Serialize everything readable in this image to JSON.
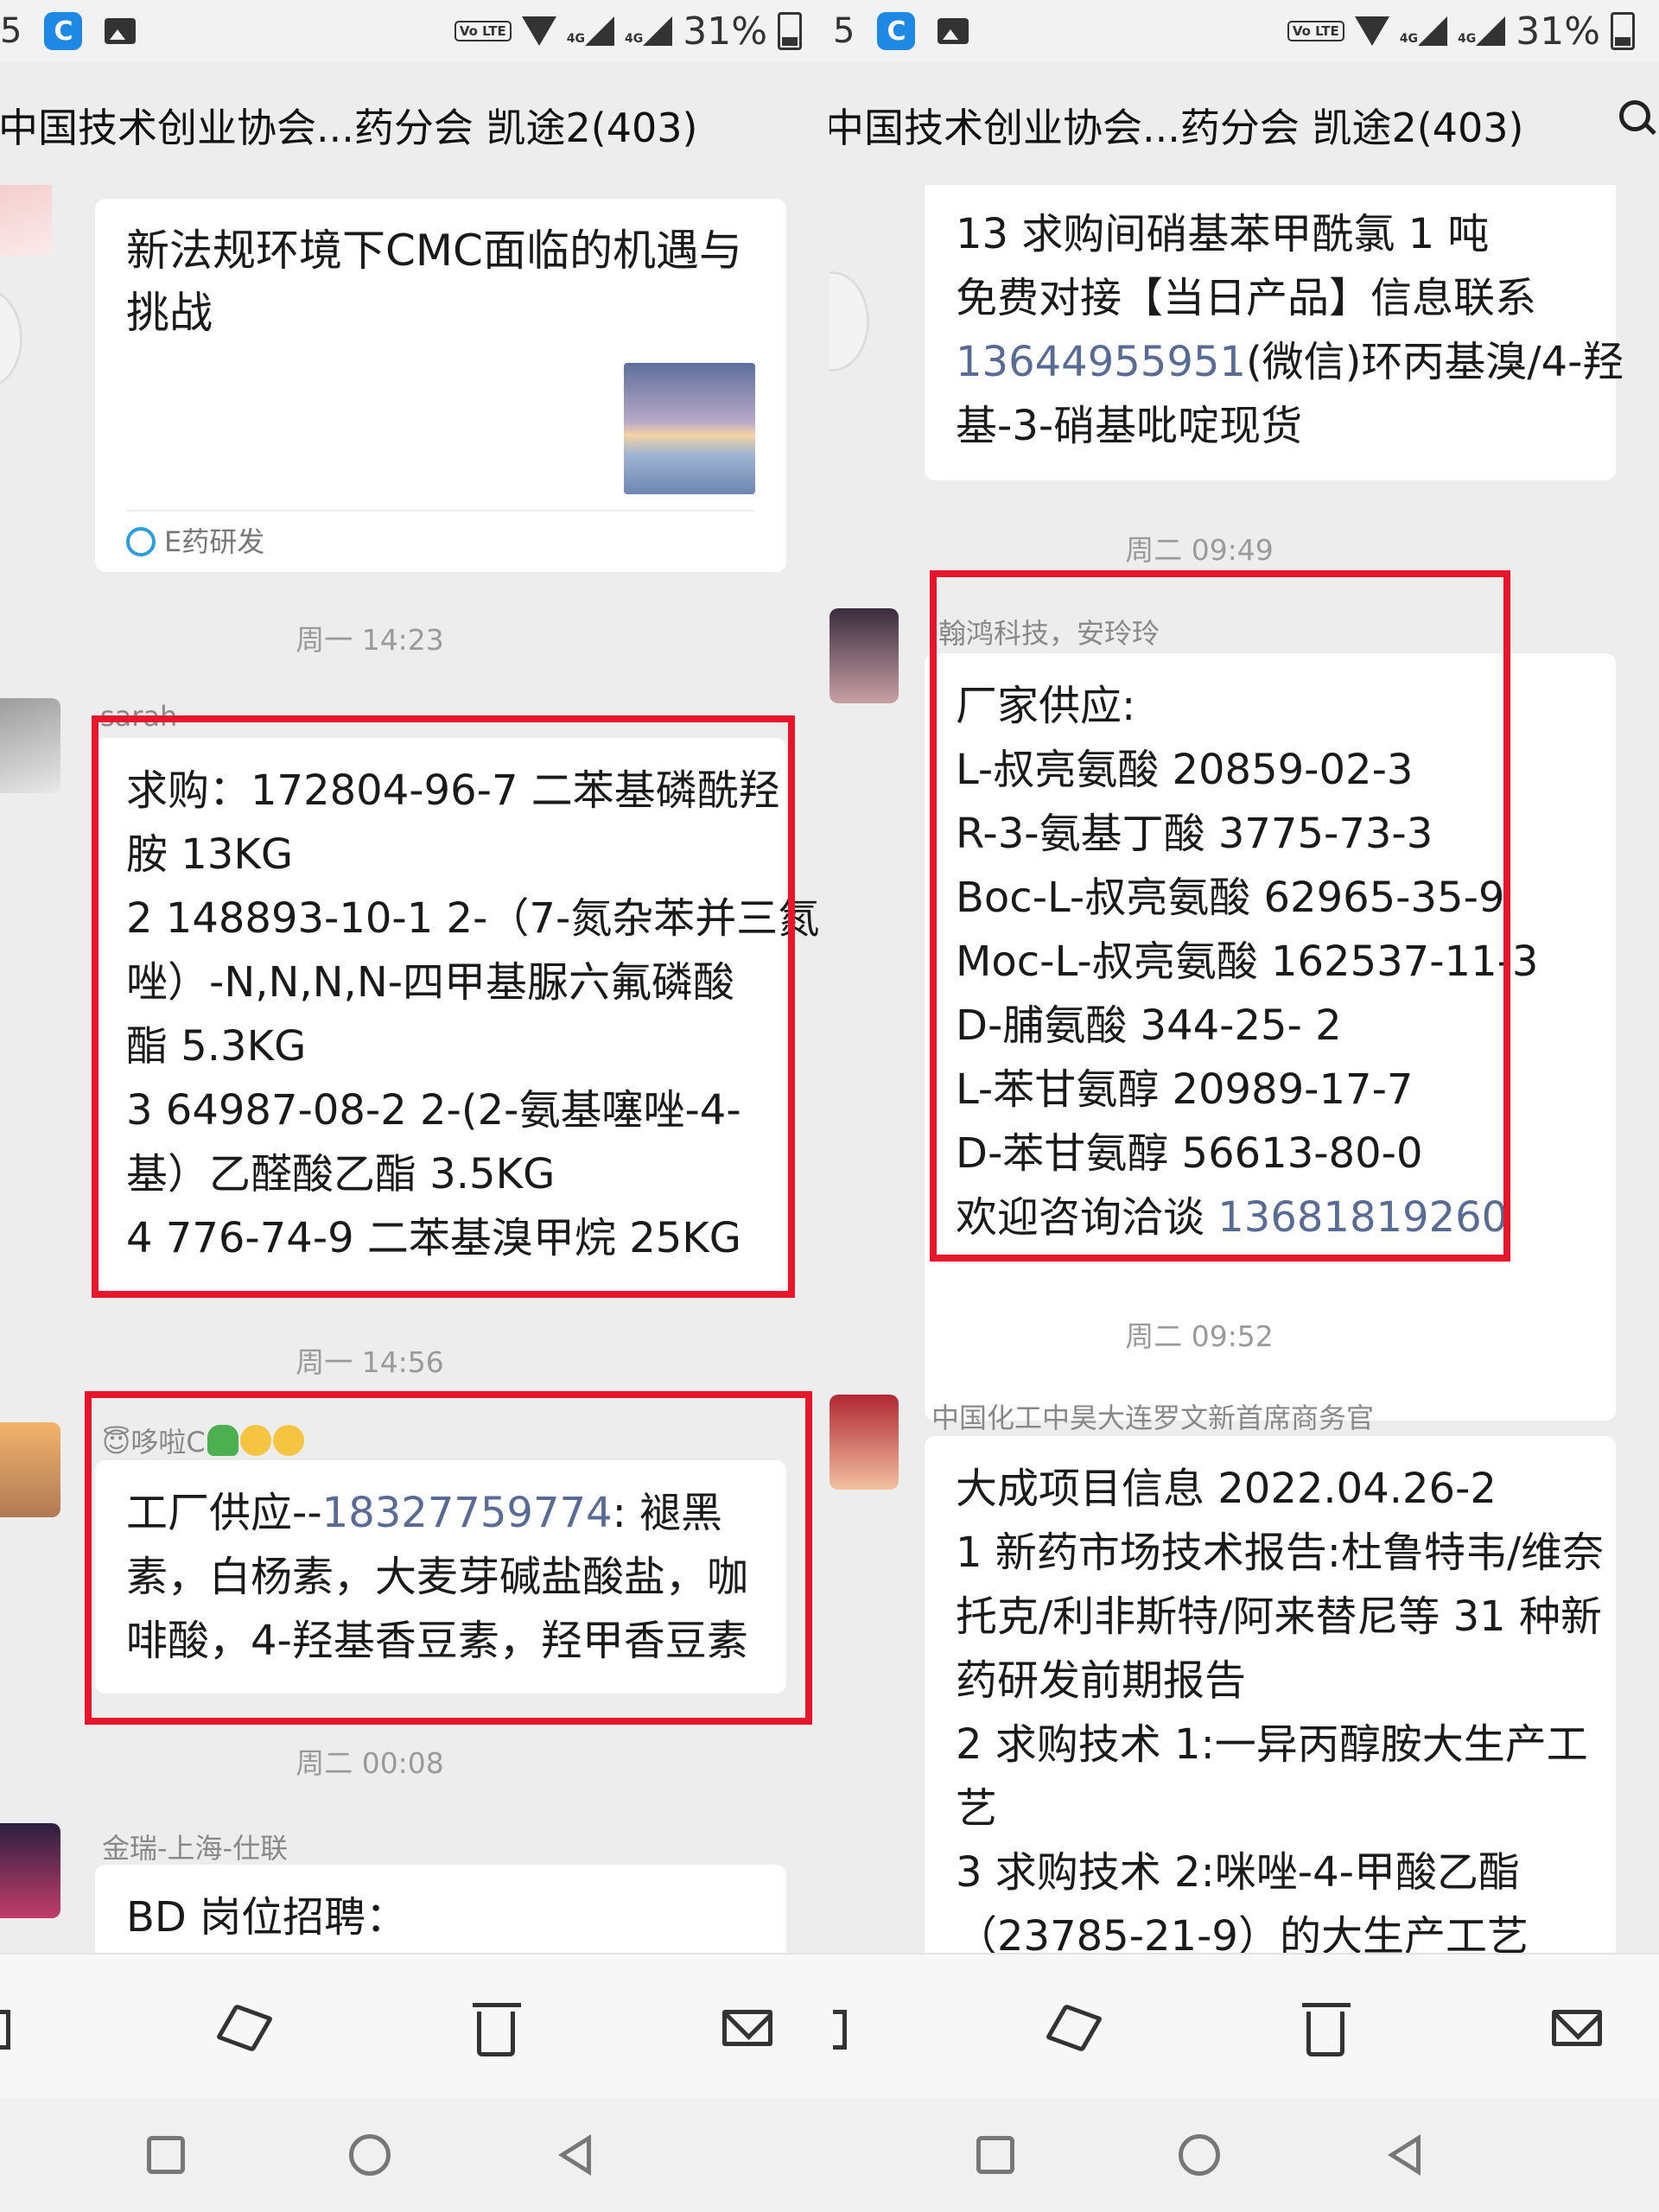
{
  "status_bar": {
    "left_digit": "5",
    "volte": "Vo LTE",
    "network": "4G",
    "battery": "31%"
  },
  "header": {
    "title": "中国技术创业协会...药分会 凯途2(403)"
  },
  "left_pane": {
    "card_message": {
      "title_lines": [
        "新法规环境下CMC面临的机遇与",
        "挑战"
      ],
      "source": "E药研发"
    },
    "time_1": "周一 14:23",
    "msg_sarah": {
      "sender": "sarah",
      "lines": [
        "求购：172804-96-7 二苯基磷酰羟",
        "胺 13KG",
        "2 148893-10-1 2-（7-氮杂苯并三氮",
        "唑）-N,N,N,N-四甲基脲六氟磷酸",
        "酯  5.3KG",
        "3 64987-08-2  2-(2-氨基噻唑-4-",
        "基）乙醛酸乙酯 3.5KG",
        "4 776-74-9 二苯基溴甲烷 25KG"
      ]
    },
    "time_2": "周一 14:56",
    "msg_duola": {
      "sender": "😇哆啦C",
      "line1_prefix": "工厂供应--",
      "line1_phone": "18327759774",
      "line1_suffix": ":    褪黑",
      "lines_rest": [
        "素，白杨素，大麦芽碱盐酸盐，咖",
        "啡酸，4-羟基香豆素，羟甲香豆素"
      ]
    },
    "time_3": "周二 00:08",
    "msg_jinrui": {
      "sender": "金瑞-上海-仕联",
      "first_line": "BD 岗位招聘："
    }
  },
  "right_pane": {
    "msg_top": {
      "line1": "13 求购间硝基苯甲酰氯 1 吨",
      "line2": "免费对接【当日产品】信息联系",
      "line3_phone": "13644955951",
      "line3_rest": "(微信)环丙基溴/4-羟",
      "line4": "基-3-硝基吡啶现货"
    },
    "time_1": "周二 09:49",
    "msg_hanhong": {
      "sender": "翰鸿科技，安玲玲",
      "lines": [
        "厂家供应:",
        "L-叔亮氨酸   20859-02-3",
        "R-3-氨基丁酸   3775-73-3",
        "Boc-L-叔亮氨酸  62965-35-9",
        "Moc-L-叔亮氨酸   162537-11-3",
        "D-脯氨酸 344-25- 2",
        "L-苯甘氨醇 20989-17-7",
        "D-苯甘氨醇 56613-80-0"
      ],
      "last_prefix": "欢迎咨询洽谈 ",
      "last_phone": "13681819260"
    },
    "time_2": "周二 09:52",
    "msg_sinochem": {
      "sender": "中国化工中昊大连罗文新首席商务官",
      "lines": [
        "大成项目信息 2022.04.26-2",
        "1 新药市场技术报告:杜鲁特韦/维奈",
        "托克/利非斯特/阿来替尼等 31 种新",
        "药研发前期报告",
        "2 求购技术 1:一异丙醇胺大生产工",
        "艺",
        "3 求购技术 2:咪唑-4-甲酸乙酯",
        "（23785-21-9）的大生产工艺"
      ]
    }
  },
  "toolbar_icons": [
    "share-icon",
    "cube-icon",
    "trash-icon",
    "mail-icon"
  ],
  "navbar_icons": [
    "recent-apps-icon",
    "home-icon",
    "back-icon"
  ],
  "colors": {
    "highlight_box": "#e8162b",
    "link": "#576b95",
    "bubble": "#ffffff",
    "background": "#ededed"
  }
}
